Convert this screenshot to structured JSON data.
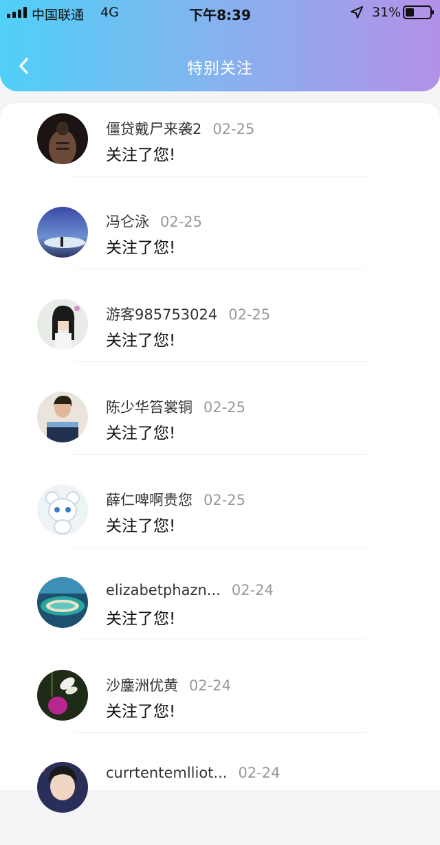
{
  "status_bar": {
    "carrier": "中国联通",
    "network": "4G",
    "time": "下午8:39",
    "battery": "31%"
  },
  "header": {
    "title": "特别关注",
    "back_icon": "chevron-left-icon"
  },
  "colors": {
    "header_gradient_start": "#4fd0f7",
    "header_gradient_end": "#b391e8",
    "date_gray": "#999999"
  },
  "notifications": [
    {
      "name": "僵贷戴尸来袭2",
      "date": "02-25",
      "action": "关注了您!"
    },
    {
      "name": "冯仑泳",
      "date": "02-25",
      "action": "关注了您!"
    },
    {
      "name": "游客985753024",
      "date": "02-25",
      "action": "关注了您!"
    },
    {
      "name": "陈少华笞裳铜",
      "date": "02-25",
      "action": "关注了您!"
    },
    {
      "name": "薛仁啤啊贵您",
      "date": "02-25",
      "action": "关注了您!"
    },
    {
      "name": "elizabetphazn...",
      "date": "02-24",
      "action": "关注了您!"
    },
    {
      "name": "沙鏖洲优黄",
      "date": "02-24",
      "action": "关注了您!"
    },
    {
      "name": "currtentemlliot...",
      "date": "02-24",
      "action": ""
    }
  ]
}
